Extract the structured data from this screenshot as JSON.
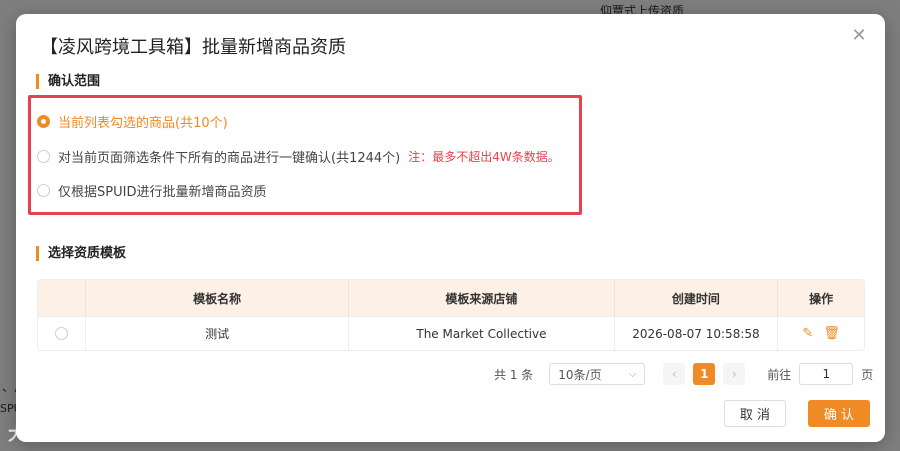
{
  "background": {
    "top_text": "仰覃式上传资质",
    "left_text1": "、片",
    "left_text2": "SPU",
    "watermark": "大数跨境"
  },
  "modal": {
    "title": "【凌风跨境工具箱】批量新增商品资质",
    "close_icon": "close-icon"
  },
  "scope": {
    "title": "确认范围",
    "options": [
      {
        "label": "当前列表勾选的商品(共10个)",
        "checked": true
      },
      {
        "label": "对当前页面筛选条件下所有的商品进行一键确认(共1244个)",
        "note": "注：最多不超出4W条数据。",
        "checked": false
      },
      {
        "label": "仅根据SPUID进行批量新增商品资质",
        "checked": false
      }
    ]
  },
  "template": {
    "title": "选择资质模板",
    "columns": [
      "",
      "模板名称",
      "模板来源店铺",
      "创建时间",
      "操作"
    ],
    "rows": [
      {
        "name": "测试",
        "shop": "The Market Collective",
        "created": "2026-08-07 10:58:58"
      }
    ]
  },
  "pagination": {
    "total": "共 1 条",
    "page_size": "10条/页",
    "current_page": "1",
    "goto_label": "前往",
    "goto_value": "1",
    "goto_suffix": "页"
  },
  "footer": {
    "cancel_label": "取 消",
    "confirm_label": "确 认"
  },
  "colors": {
    "accent": "#f08a24",
    "highlight_border": "#e5424f",
    "note": "#e5424f"
  }
}
